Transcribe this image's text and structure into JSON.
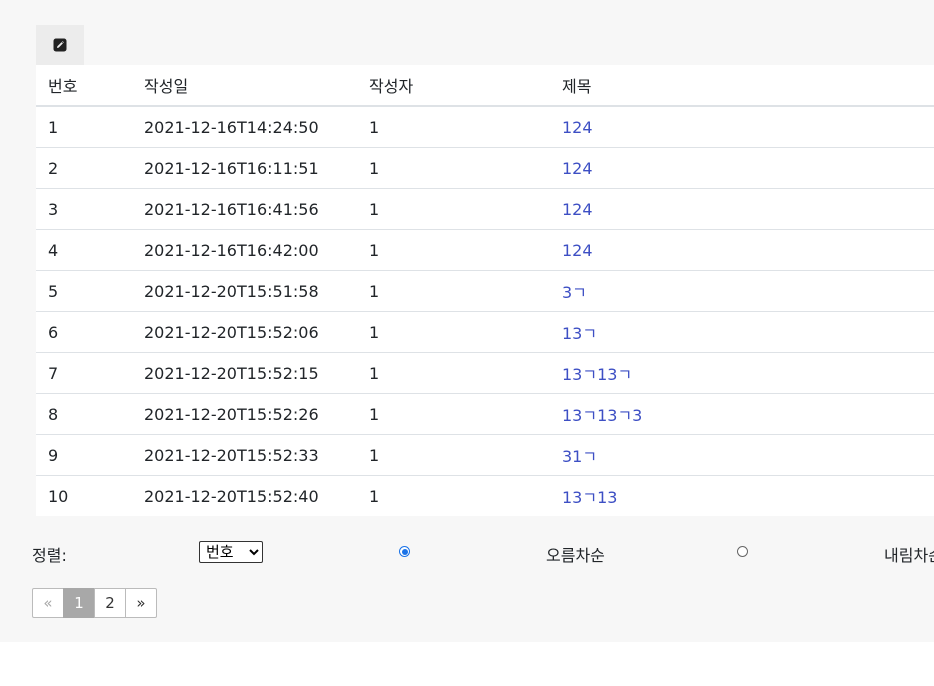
{
  "toolbar": {
    "write_icon": "edit-pencil-icon"
  },
  "table": {
    "headers": {
      "no": "번호",
      "date": "작성일",
      "author": "작성자",
      "title": "제목"
    },
    "rows": [
      {
        "no": "1",
        "date": "2021-12-16T14:24:50",
        "author": "1",
        "title": "124"
      },
      {
        "no": "2",
        "date": "2021-12-16T16:11:51",
        "author": "1",
        "title": "124"
      },
      {
        "no": "3",
        "date": "2021-12-16T16:41:56",
        "author": "1",
        "title": "124"
      },
      {
        "no": "4",
        "date": "2021-12-16T16:42:00",
        "author": "1",
        "title": "124"
      },
      {
        "no": "5",
        "date": "2021-12-20T15:51:58",
        "author": "1",
        "title": "3ㄱ"
      },
      {
        "no": "6",
        "date": "2021-12-20T15:52:06",
        "author": "1",
        "title": "13ㄱ"
      },
      {
        "no": "7",
        "date": "2021-12-20T15:52:15",
        "author": "1",
        "title": "13ㄱ13ㄱ"
      },
      {
        "no": "8",
        "date": "2021-12-20T15:52:26",
        "author": "1",
        "title": "13ㄱ13ㄱ3"
      },
      {
        "no": "9",
        "date": "2021-12-20T15:52:33",
        "author": "1",
        "title": "31ㄱ"
      },
      {
        "no": "10",
        "date": "2021-12-20T15:52:40",
        "author": "1",
        "title": "13ㄱ13"
      }
    ]
  },
  "sort": {
    "label": "정렬:",
    "selected": "번호",
    "asc_label": "오름차순",
    "desc_label": "내림차순",
    "order": "asc"
  },
  "pagination": {
    "prev": "«",
    "pages": [
      "1",
      "2"
    ],
    "current": "1",
    "next": "»"
  },
  "colors": {
    "link": "#3d4fc4",
    "active_page": "#a8a8a8",
    "panel": "#f7f7f7"
  }
}
